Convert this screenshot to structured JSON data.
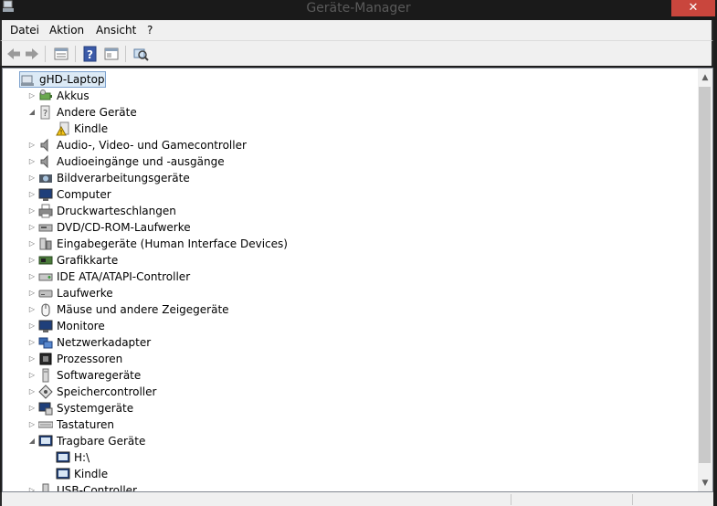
{
  "window": {
    "title": "Geräte-Manager",
    "close_glyph": "✕"
  },
  "menu": [
    {
      "label": "Datei"
    },
    {
      "label": "Aktion"
    },
    {
      "label": "Ansicht"
    },
    {
      "label": "?"
    }
  ],
  "toolbar": {
    "buttons": [
      "back-arrow-icon",
      "forward-arrow-icon",
      "properties-icon",
      "help-icon",
      "show-hidden-icon",
      "scan-hardware-icon"
    ]
  },
  "tree": {
    "root": {
      "label": "gHD-Laptop",
      "icon": "computer-icon",
      "expanded": true,
      "selected": true
    },
    "items": [
      {
        "label": "Akkus",
        "icon": "battery-icon",
        "level": 1,
        "expander": "collapsed"
      },
      {
        "label": "Andere Geräte",
        "icon": "unknown-device-icon",
        "level": 1,
        "expander": "expanded"
      },
      {
        "label": "Kindle",
        "icon": "warning-device-icon",
        "level": 2,
        "expander": "none"
      },
      {
        "label": "Audio-, Video- und Gamecontroller",
        "icon": "speaker-icon",
        "level": 1,
        "expander": "collapsed"
      },
      {
        "label": "Audioeingänge und -ausgänge",
        "icon": "speaker-icon",
        "level": 1,
        "expander": "collapsed"
      },
      {
        "label": "Bildverarbeitungsgeräte",
        "icon": "camera-icon",
        "level": 1,
        "expander": "collapsed"
      },
      {
        "label": "Computer",
        "icon": "monitor-icon",
        "level": 1,
        "expander": "collapsed"
      },
      {
        "label": "Druckwarteschlangen",
        "icon": "printer-icon",
        "level": 1,
        "expander": "collapsed"
      },
      {
        "label": "DVD/CD-ROM-Laufwerke",
        "icon": "optical-drive-icon",
        "level": 1,
        "expander": "collapsed"
      },
      {
        "label": "Eingabegeräte (Human Interface Devices)",
        "icon": "hid-icon",
        "level": 1,
        "expander": "collapsed"
      },
      {
        "label": "Grafikkarte",
        "icon": "display-adapter-icon",
        "level": 1,
        "expander": "collapsed"
      },
      {
        "label": "IDE ATA/ATAPI-Controller",
        "icon": "ide-controller-icon",
        "level": 1,
        "expander": "collapsed"
      },
      {
        "label": "Laufwerke",
        "icon": "disk-drive-icon",
        "level": 1,
        "expander": "collapsed"
      },
      {
        "label": "Mäuse und andere Zeigegeräte",
        "icon": "mouse-icon",
        "level": 1,
        "expander": "collapsed"
      },
      {
        "label": "Monitore",
        "icon": "monitor-icon",
        "level": 1,
        "expander": "collapsed"
      },
      {
        "label": "Netzwerkadapter",
        "icon": "network-adapter-icon",
        "level": 1,
        "expander": "collapsed"
      },
      {
        "label": "Prozessoren",
        "icon": "processor-icon",
        "level": 1,
        "expander": "collapsed"
      },
      {
        "label": "Softwaregeräte",
        "icon": "software-device-icon",
        "level": 1,
        "expander": "collapsed"
      },
      {
        "label": "Speichercontroller",
        "icon": "storage-controller-icon",
        "level": 1,
        "expander": "collapsed"
      },
      {
        "label": "Systemgeräte",
        "icon": "system-device-icon",
        "level": 1,
        "expander": "collapsed"
      },
      {
        "label": "Tastaturen",
        "icon": "keyboard-icon",
        "level": 1,
        "expander": "collapsed"
      },
      {
        "label": "Tragbare Geräte",
        "icon": "portable-device-icon",
        "level": 1,
        "expander": "expanded"
      },
      {
        "label": "H:\\",
        "icon": "portable-device-icon",
        "level": 2,
        "expander": "none"
      },
      {
        "label": "Kindle",
        "icon": "portable-device-icon",
        "level": 2,
        "expander": "none"
      },
      {
        "label": "USB-Controller",
        "icon": "usb-icon",
        "level": 1,
        "expander": "collapsed"
      }
    ]
  },
  "colors": {
    "selection_bg": "#dceaf6",
    "selection_border": "#7da2ce",
    "close_button": "#c9463d"
  }
}
